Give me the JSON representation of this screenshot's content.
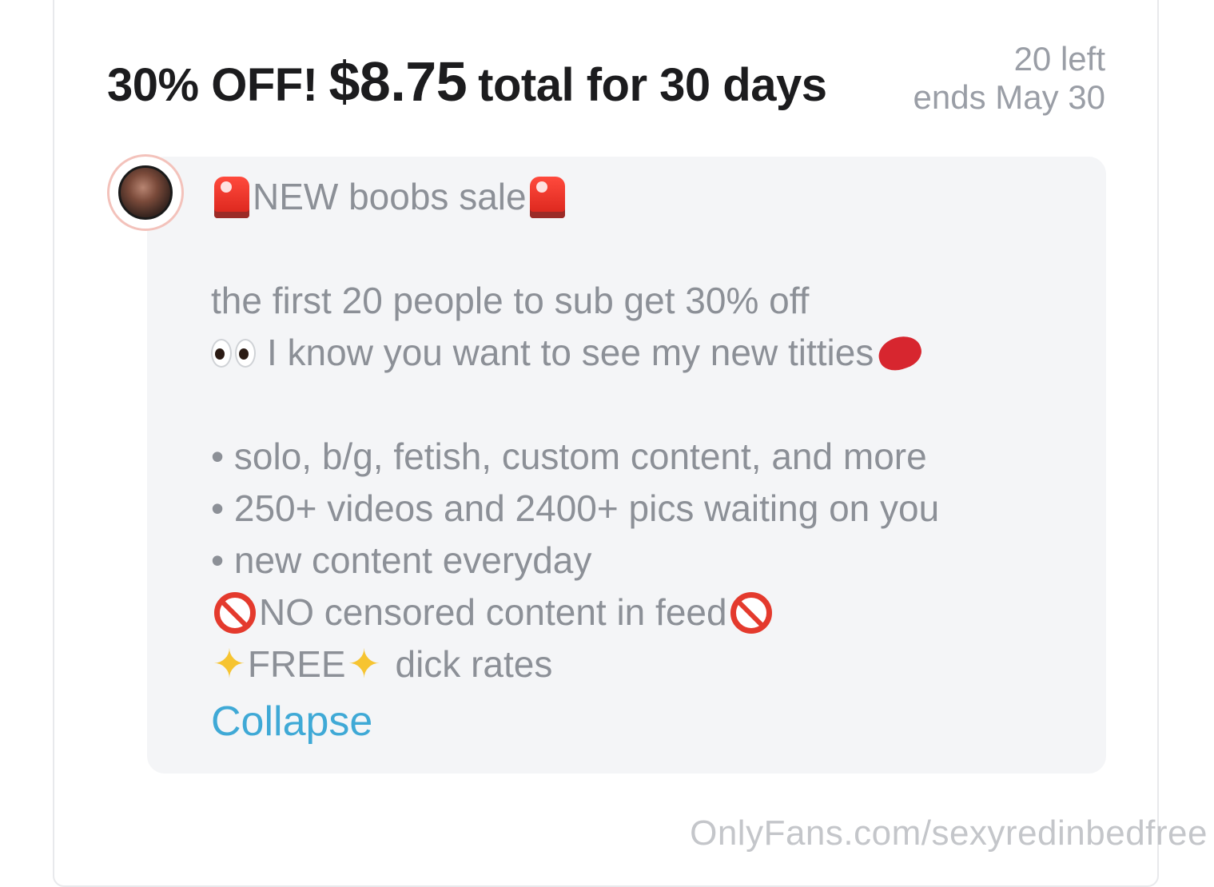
{
  "offer": {
    "discount": "30% OFF!",
    "price": "$8.75",
    "duration": "total for 30 days",
    "remaining": "20 left",
    "ends": "ends May 30"
  },
  "post": {
    "headline": "NEW boobs sale",
    "line1": "the first 20 people to sub get 30% off",
    "line2": "I know you want to see my new titties",
    "bullet1": "• solo, b/g, fetish, custom content, and more",
    "bullet2": "• 250+ videos and 2400+ pics waiting on you",
    "bullet3": "• new content everyday",
    "no_censor": "NO censored content in feed",
    "free_word": "FREE",
    "free_rest": "dick rates",
    "sparkle_glyph": "✦",
    "collapse_label": "Collapse"
  },
  "icons": {
    "headline": "siren-icon",
    "eyes": "eyes-icon",
    "lips": "kiss-mark-icon",
    "no_entry": "prohibited-icon",
    "sparkles": "sparkles-icon"
  },
  "colors": {
    "link": "#3fa9d6",
    "muted_text": "#8c9097",
    "avatar_ring": "#f3c2bb"
  },
  "watermark": "OnlyFans.com/sexyredinbedfree"
}
